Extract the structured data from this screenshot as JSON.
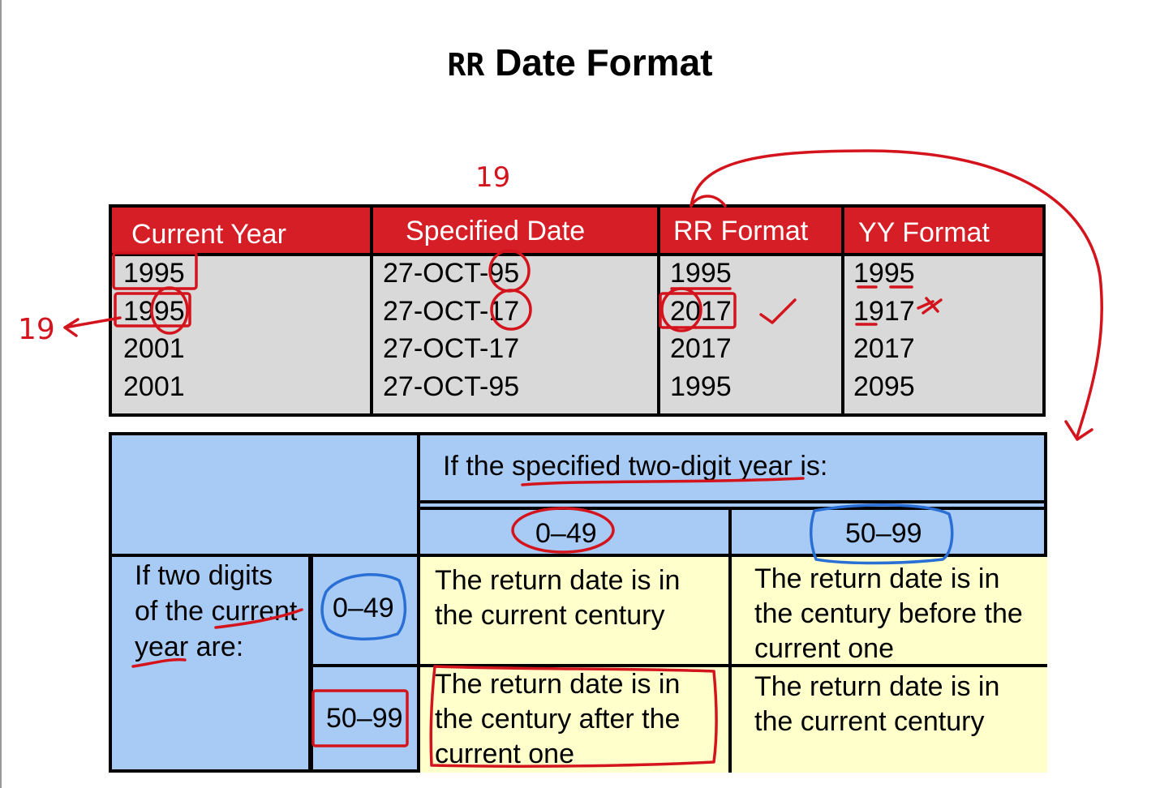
{
  "title": {
    "prefix": "RR",
    "main": "Date Format"
  },
  "top_table": {
    "headers": [
      "Current Year",
      "Specified Date",
      "RR Format",
      "YY Format"
    ],
    "rows": [
      [
        "1995",
        "27-OCT-95",
        "1995",
        "1995"
      ],
      [
        "1995",
        "27-OCT-17",
        "2017",
        "1917"
      ],
      [
        "2001",
        "27-OCT-17",
        "2017",
        "2017"
      ],
      [
        "2001",
        "27-OCT-95",
        "1995",
        "2095"
      ]
    ]
  },
  "bottom_table": {
    "specified_header": "If the specified two-digit year is:",
    "col_ranges": [
      "0–49",
      "50–99"
    ],
    "row_header": [
      "If two digits",
      "of the current",
      "year are:"
    ],
    "row_ranges": [
      "0–49",
      "50–99"
    ],
    "cells": {
      "r1c1": [
        "The return date is in",
        "the current century"
      ],
      "r1c2": [
        "The return date is in",
        "the century before the",
        "current one"
      ],
      "r2c1": [
        "The return date is in",
        "the century after the",
        "current one"
      ],
      "r2c2": [
        "The return date is in",
        "the current century"
      ]
    }
  },
  "annotations": {
    "note_top": "19",
    "note_left": "19"
  },
  "colors": {
    "header_red": "#d61e26",
    "table_gray": "#d9d9d9",
    "blue": "#a8cbf5",
    "yellow": "#ffffcc",
    "ink_red": "#d4141c",
    "ink_blue": "#2a6fd6"
  }
}
